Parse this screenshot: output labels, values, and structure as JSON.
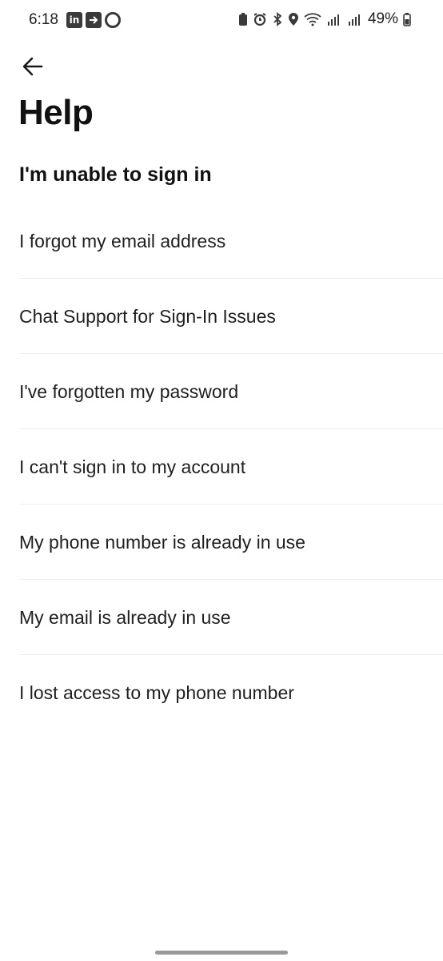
{
  "status_bar": {
    "time": "6:18",
    "battery_percent": "49%",
    "left_icons": [
      "linkedin-icon",
      "cast-icon",
      "chrome-icon"
    ],
    "right_icons": [
      "battery-saver-icon",
      "alarm-icon",
      "bluetooth-icon",
      "location-icon",
      "wifi-icon",
      "signal-r-icon",
      "signal-icon",
      "battery-icon"
    ]
  },
  "header": {
    "back_icon": "arrow-left-icon",
    "title": "Help"
  },
  "section": {
    "heading": "I'm unable to sign in",
    "items": [
      {
        "label": "I forgot my email address"
      },
      {
        "label": "Chat Support for Sign-In Issues"
      },
      {
        "label": "I've forgotten my password"
      },
      {
        "label": "I can't sign in to my account"
      },
      {
        "label": "My phone number is already in use"
      },
      {
        "label": "My email is already in use"
      },
      {
        "label": "I lost access to my phone number"
      }
    ]
  },
  "colors": {
    "text": "#1f1f1f",
    "divider": "#eeeeee",
    "background": "#ffffff"
  }
}
